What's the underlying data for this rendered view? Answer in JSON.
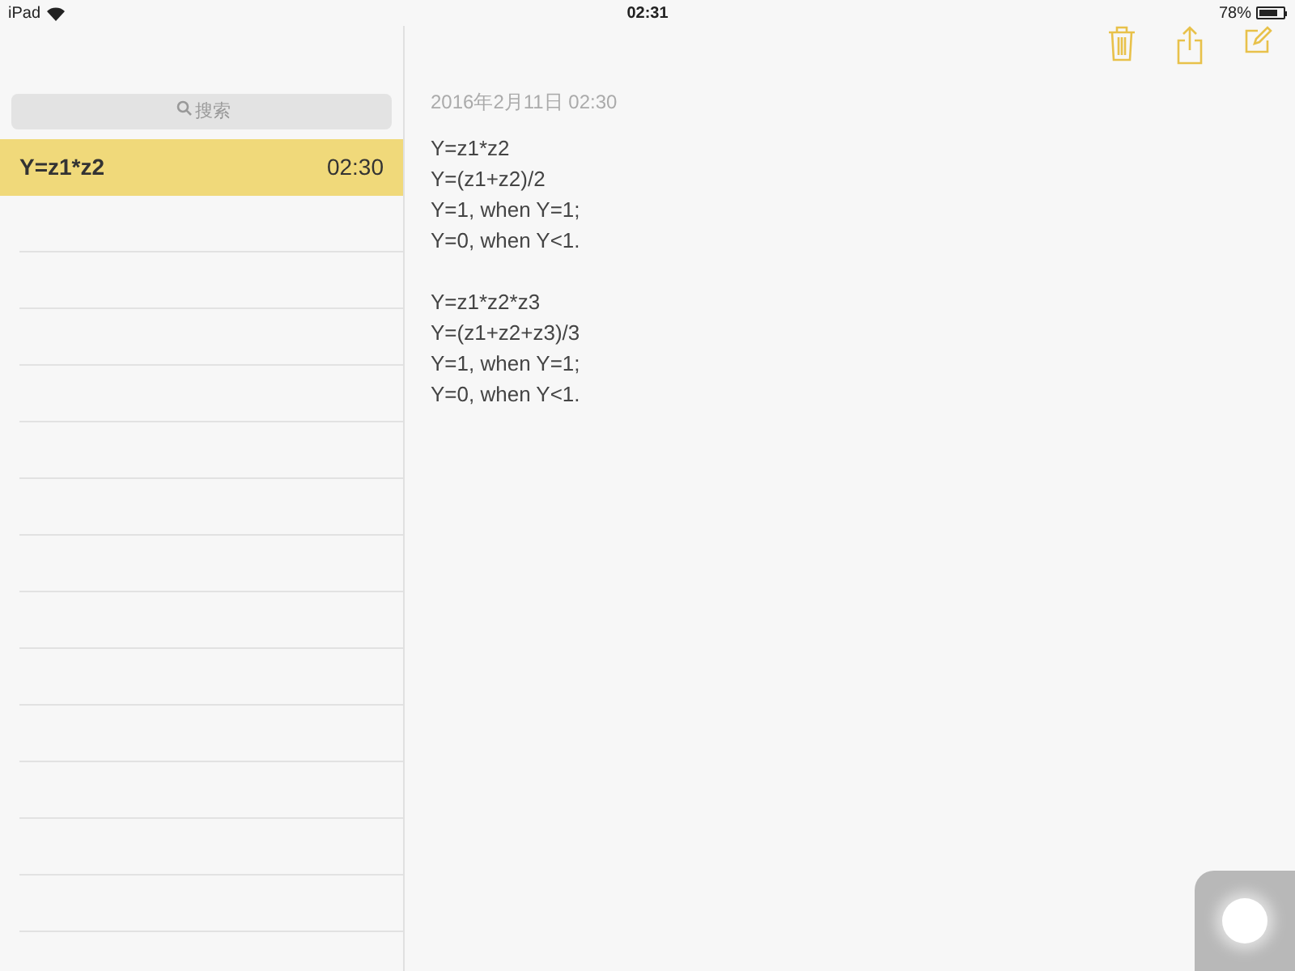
{
  "status_bar": {
    "device": "iPad",
    "time": "02:31",
    "battery": "78%"
  },
  "sidebar": {
    "search": {
      "placeholder": "搜索"
    },
    "notes": [
      {
        "title": "Y=z1*z2",
        "time": "02:30",
        "selected": true
      }
    ]
  },
  "note": {
    "date": "2016年2月11日 02:30",
    "paragraphs": [
      [
        "Y=z1*z2",
        "Y=(z1+z2)/2",
        "Y=1, when Y=1;",
        "Y=0, when Y<1."
      ],
      [
        "Y=z1*z2*z3",
        "Y=(z1+z2+z3)/3",
        "Y=1, when Y=1;",
        "Y=0, when Y<1."
      ]
    ]
  }
}
